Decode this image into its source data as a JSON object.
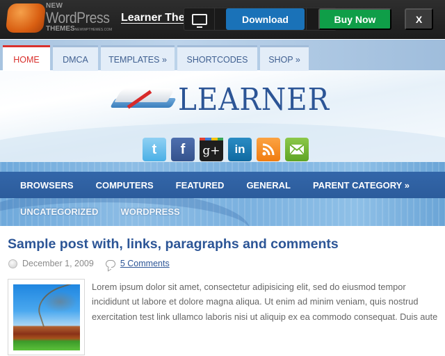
{
  "topbar": {
    "brand": {
      "line1": "NEW",
      "line2": "WordPress",
      "line3": "THEMES",
      "line3_small": "NEWWPTHEMES.COM"
    },
    "theme_title": "Learner Theme",
    "devices": [
      {
        "name": "desktop",
        "icon": "monitor-icon",
        "active": true
      },
      {
        "name": "tablet-landscape",
        "icon": "tablet-icon"
      },
      {
        "name": "tablet-portrait",
        "icon": "tablet-icon"
      },
      {
        "name": "phone",
        "icon": "phone-icon"
      },
      {
        "name": "phone-small",
        "icon": "phone-icon"
      }
    ],
    "download_label": "Download",
    "buy_label": "Buy Now",
    "close_label": "X",
    "colors": {
      "download": "#1a72b8",
      "buy": "#0f9e48"
    }
  },
  "topnav": {
    "items": [
      {
        "label": "HOME",
        "active": true
      },
      {
        "label": "DMCA"
      },
      {
        "label": "TEMPLATES »"
      },
      {
        "label": "SHORTCODES"
      },
      {
        "label": "SHOP »"
      }
    ],
    "active_color": "#d9302c"
  },
  "site": {
    "title": "LEARNER",
    "logo_icon": "open-book-icon"
  },
  "social": [
    {
      "name": "twitter",
      "glyph": "t"
    },
    {
      "name": "facebook",
      "glyph": "f"
    },
    {
      "name": "google-plus",
      "glyph": "g+"
    },
    {
      "name": "linkedin",
      "glyph": "in"
    },
    {
      "name": "rss",
      "glyph": "rss"
    },
    {
      "name": "email",
      "glyph": "✉"
    }
  ],
  "categories": {
    "row1": [
      "BROWSERS",
      "COMPUTERS",
      "FEATURED",
      "GENERAL",
      "PARENT CATEGORY »"
    ],
    "row2": [
      "UNCATEGORIZED",
      "WORDPRESS"
    ]
  },
  "post": {
    "title": "Sample post with, links, paragraphs and comments",
    "date": "December 1, 2009",
    "comments": "5 Comments",
    "excerpt": "Lorem ipsum dolor sit amet, consectetur adipisicing elit, sed do eiusmod tempor  incididunt ut labore et dolore magna aliqua. Ut enim ad minim veniam, quis nostrud exercitation test link ullamco laboris nisi ut aliquip ex ea commodo consequat. Duis aute"
  }
}
